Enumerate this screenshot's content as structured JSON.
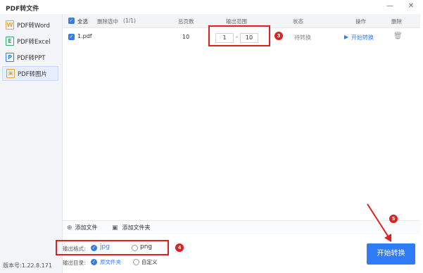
{
  "app": {
    "title": "PDF转文件"
  },
  "window": {
    "minimize": "—",
    "close": "✕"
  },
  "sidebar": {
    "items": [
      {
        "label": "PDF转Word",
        "icon_letter": "W",
        "icon_color": "#e8a23a"
      },
      {
        "label": "PDF转Excel",
        "icon_letter": "E",
        "icon_color": "#3aa86b"
      },
      {
        "label": "PDF转PPT",
        "icon_letter": "P",
        "icon_color": "#3a7be8"
      },
      {
        "label": "PDF转图片",
        "icon_letter": "▣",
        "icon_color": "#e8a23a"
      }
    ],
    "active_index": 3,
    "version": "版本号:1.22.8.171"
  },
  "table": {
    "headers": {
      "select_all": "全选",
      "clear_list": "删除选中",
      "count": "(1/1)",
      "total_pages": "总页数",
      "range": "输出范围",
      "status": "状态",
      "action": "操作",
      "delete": "删除"
    },
    "rows": [
      {
        "file": "1.pdf",
        "pages": "10",
        "from": "1",
        "dash": "-",
        "to": "10",
        "status": "待转换",
        "action": "开始转换"
      }
    ]
  },
  "annotations": {
    "b3": "3",
    "b4": "4",
    "b5": "5",
    "accent": "#e02020"
  },
  "bottom": {
    "add_file": "添加文件",
    "add_folder": "添加文件夹"
  },
  "output": {
    "format_label": "输出格式:",
    "format_options": [
      "jpg",
      "png"
    ],
    "format_selected": "jpg",
    "dir_label": "输出目录:",
    "dir_options": [
      "原文件夹",
      "自定义"
    ],
    "dir_selected": "原文件夹"
  },
  "start_button": "开始转换",
  "colors": {
    "primary": "#2f7cf6"
  }
}
